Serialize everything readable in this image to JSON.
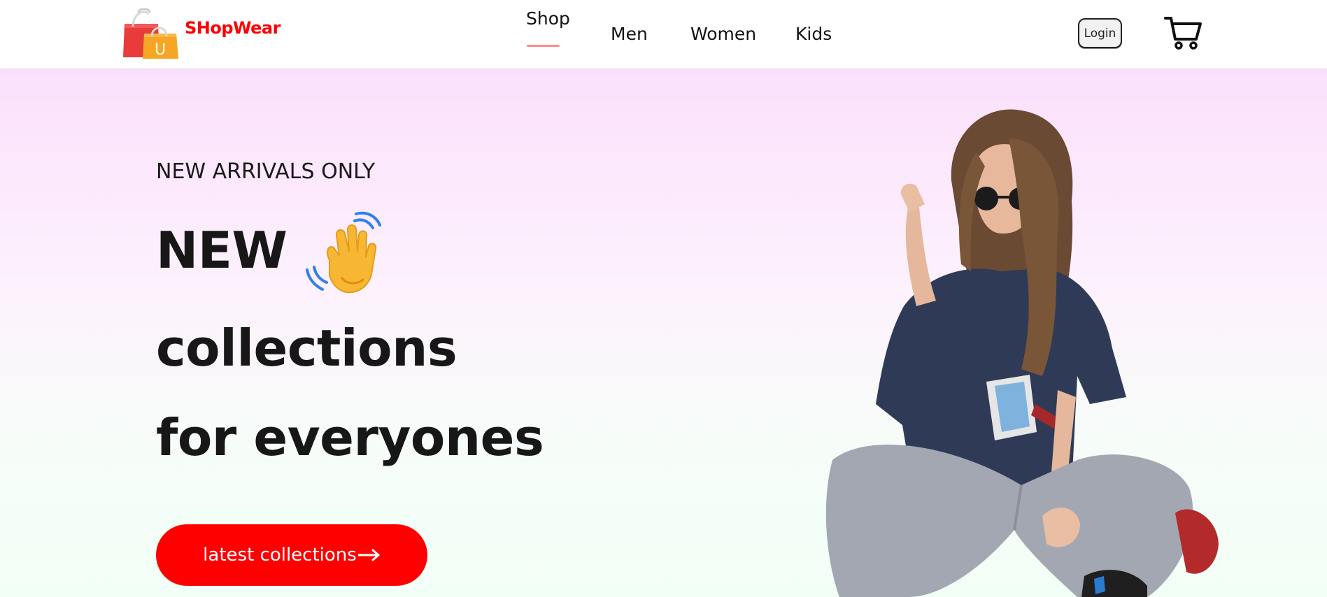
{
  "brand": {
    "name": "SHopWear",
    "logo_icon": "shopping-bag-icon",
    "logo_letter": "U",
    "color": "#ff0000"
  },
  "nav": {
    "items": [
      {
        "label": "Shop",
        "active": true
      },
      {
        "label": "Men",
        "active": false
      },
      {
        "label": "Women",
        "active": false
      },
      {
        "label": "Kids",
        "active": false
      }
    ],
    "active_underline_color": "#ff8a8a",
    "login_label": "Login",
    "cart_icon": "cart-icon"
  },
  "hero": {
    "eyebrow": "NEW ARRIVALS ONLY",
    "line1": "NEW",
    "wave_icon": "waving-hand-icon",
    "line2": "collections",
    "line3": "for everyones",
    "cta_label": "latest collections",
    "cta_arrow_icon": "arrow-right-icon",
    "cta_color": "#ff0000",
    "image": "hero-model-image",
    "gradient_colors": [
      "#fbe0fc",
      "#f2fff7"
    ]
  }
}
